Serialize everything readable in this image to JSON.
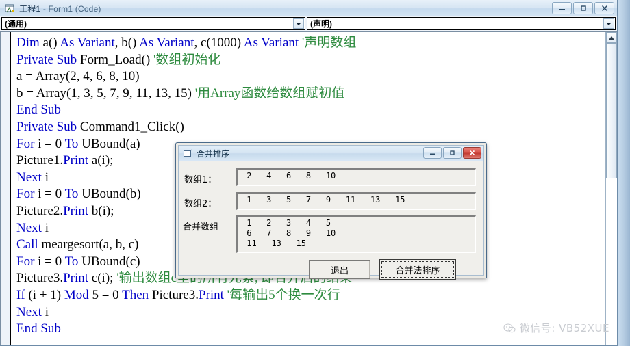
{
  "window": {
    "title_project": "工程1",
    "title_sep": " - ",
    "title_form": "Form1 (Code)",
    "icon": "vb-code-window-icon",
    "buttons": {
      "minimize": "minimize-icon",
      "maximize": "maximize-icon",
      "close": "close-icon"
    }
  },
  "combos": {
    "object": "(通用)",
    "procedure": "(声明)",
    "arrow_icon": "chevron-down-icon"
  },
  "code": {
    "lines": [
      [
        {
          "t": "Dim ",
          "c": "kw"
        },
        {
          "t": "a() ",
          "c": "tx"
        },
        {
          "t": "As Variant",
          "c": "kw"
        },
        {
          "t": ", b() ",
          "c": "tx"
        },
        {
          "t": "As Variant",
          "c": "kw"
        },
        {
          "t": ", c(1000) ",
          "c": "tx"
        },
        {
          "t": "As Variant ",
          "c": "kw"
        },
        {
          "t": "'声明数组",
          "c": "cm"
        }
      ],
      [
        {
          "t": "Private Sub ",
          "c": "kw"
        },
        {
          "t": "Form_Load() ",
          "c": "tx"
        },
        {
          "t": "'数组初始化",
          "c": "cm"
        }
      ],
      [
        {
          "t": "a = Array(2, 4, 6, 8, 10)",
          "c": "tx"
        }
      ],
      [
        {
          "t": "b = Array(1, 3, 5, 7, 9, 11, 13, 15) ",
          "c": "tx"
        },
        {
          "t": "'用Array函数给数组赋初值",
          "c": "cm"
        }
      ],
      [
        {
          "t": "End Sub",
          "c": "kw"
        }
      ],
      [
        {
          "t": "Private Sub ",
          "c": "kw"
        },
        {
          "t": "Command1_Click()",
          "c": "tx"
        }
      ],
      [
        {
          "t": "For ",
          "c": "kw"
        },
        {
          "t": "i = 0 ",
          "c": "tx"
        },
        {
          "t": "To ",
          "c": "kw"
        },
        {
          "t": "UBound(a)",
          "c": "tx"
        }
      ],
      [
        {
          "t": " Picture1.",
          "c": "tx"
        },
        {
          "t": "Print ",
          "c": "kw"
        },
        {
          "t": "a(i);",
          "c": "tx"
        }
      ],
      [
        {
          "t": "Next ",
          "c": "kw"
        },
        {
          "t": "i",
          "c": "tx"
        }
      ],
      [
        {
          "t": "For ",
          "c": "kw"
        },
        {
          "t": "i = 0 ",
          "c": "tx"
        },
        {
          "t": "To ",
          "c": "kw"
        },
        {
          "t": "UBound(b)",
          "c": "tx"
        }
      ],
      [
        {
          "t": "  Picture2.",
          "c": "tx"
        },
        {
          "t": "Print ",
          "c": "kw"
        },
        {
          "t": "b(i);",
          "c": "tx"
        }
      ],
      [
        {
          "t": "Next ",
          "c": "kw"
        },
        {
          "t": "i",
          "c": "tx"
        }
      ],
      [
        {
          "t": "Call ",
          "c": "kw"
        },
        {
          "t": "meargesort(a, b, c)",
          "c": "tx"
        }
      ],
      [
        {
          "t": "For ",
          "c": "kw"
        },
        {
          "t": "i = 0 ",
          "c": "tx"
        },
        {
          "t": "To ",
          "c": "kw"
        },
        {
          "t": "UBound(c)",
          "c": "tx"
        }
      ],
      [
        {
          "t": " Picture3.",
          "c": "tx"
        },
        {
          "t": "Print ",
          "c": "kw"
        },
        {
          "t": "c(i); ",
          "c": "tx"
        },
        {
          "t": "'输出数组c里的所有元素, 即合并后的结果",
          "c": "cm"
        }
      ],
      [
        {
          "t": "If ",
          "c": "kw"
        },
        {
          "t": "(i + 1) ",
          "c": "tx"
        },
        {
          "t": "Mod ",
          "c": "kw"
        },
        {
          "t": "5 = 0 ",
          "c": "tx"
        },
        {
          "t": "Then ",
          "c": "kw"
        },
        {
          "t": "Picture3.",
          "c": "tx"
        },
        {
          "t": "Print  ",
          "c": "kw"
        },
        {
          "t": "'每输出5个换一次行",
          "c": "cm"
        }
      ],
      [
        {
          "t": "Next ",
          "c": "kw"
        },
        {
          "t": "i",
          "c": "tx"
        }
      ],
      [
        {
          "t": "End Sub",
          "c": "kw"
        }
      ]
    ],
    "colors": {
      "keyword": "#0000c8",
      "comment": "#2e8b3f",
      "text": "#000000"
    }
  },
  "scrollbar": {
    "up_arrow": "scroll-up-icon"
  },
  "dialog": {
    "title": "合并排序",
    "icon": "form-window-icon",
    "buttons": {
      "minimize": "minimize-icon",
      "maximize": "maximize-icon",
      "close": "close-icon"
    },
    "fields": [
      {
        "label": "数组1：",
        "value": " 2   4   6   8   10"
      },
      {
        "label": "数组2：",
        "value": " 1   3   5   7   9   11   13   15"
      },
      {
        "label": "合并数组",
        "value": " 1   2   3   4   5\n 6   7   8   9   10\n 11   13   15"
      }
    ],
    "actions": {
      "exit": "退出",
      "sort": "合并法排序"
    }
  },
  "watermark": {
    "icon": "wechat-icon",
    "text": "微信号: VB52XUE"
  }
}
